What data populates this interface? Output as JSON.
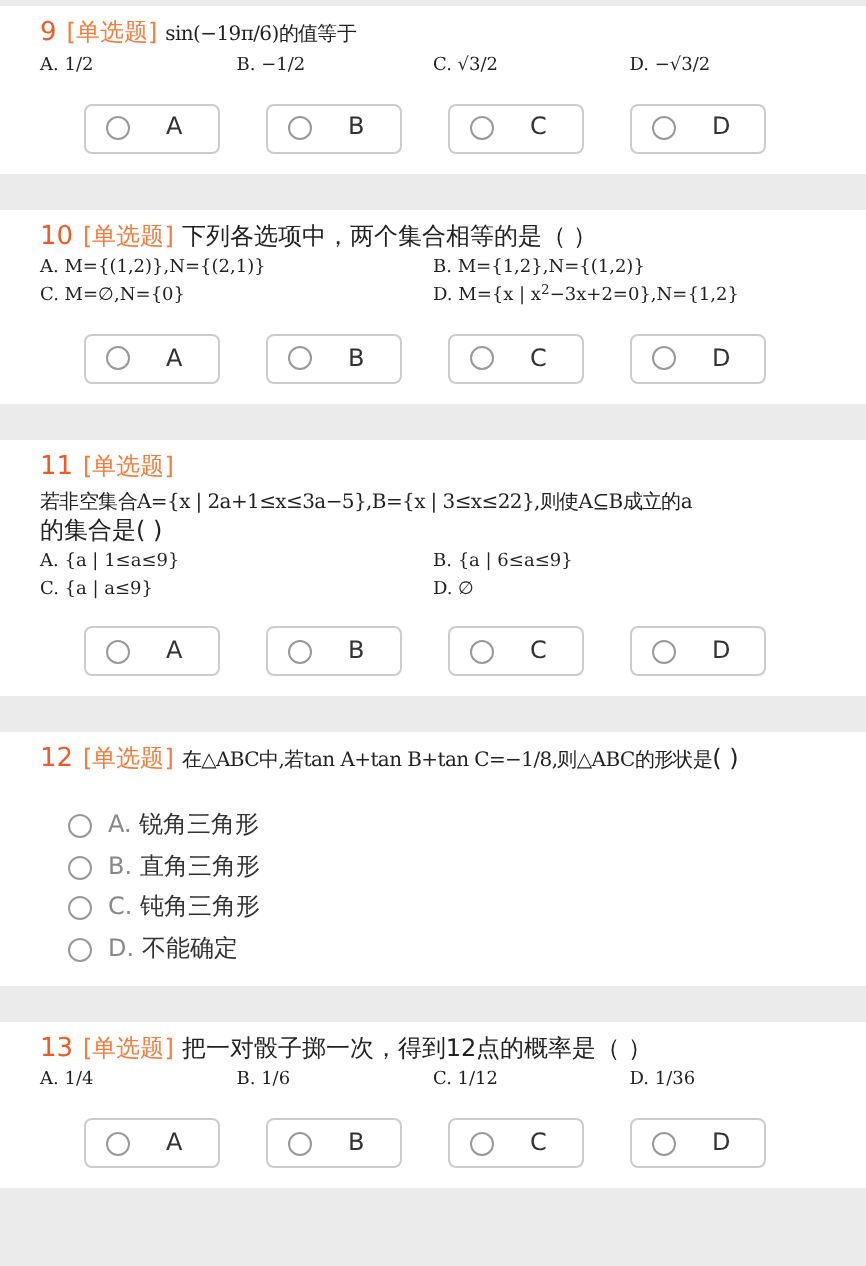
{
  "questions": [
    {
      "number": "9",
      "type_label": "[单选题]",
      "stem_math": "sin(−19π/6)的值等于",
      "kind": "buttons",
      "formula_options": [
        [
          "A. 1/2",
          "B. −1/2",
          "C. √3/2",
          "D. −√3/2"
        ]
      ],
      "choices": [
        {
          "letter": "A",
          "selected": false
        },
        {
          "letter": "B",
          "selected": false
        },
        {
          "letter": "C",
          "selected": false
        },
        {
          "letter": "D",
          "selected": false
        }
      ]
    },
    {
      "number": "10",
      "type_label": "[单选题]",
      "stem": "下列各选项中，两个集合相等的是（        ）",
      "kind": "buttons",
      "formula_options": [
        [
          "A. M={(1,2)},N={(2,1)}",
          "B. M={1,2},N={(1,2)}"
        ],
        [
          "C. M=∅,N={0}",
          "D. M={x | x$^{2}$−3x+2=0},N={1,2}"
        ]
      ],
      "choices": [
        {
          "letter": "A",
          "selected": false
        },
        {
          "letter": "B",
          "selected": false
        },
        {
          "letter": "C",
          "selected": false
        },
        {
          "letter": "D",
          "selected": false
        }
      ]
    },
    {
      "number": "11",
      "type_label": "[单选题]",
      "stem_math": "若非空集合A={x | 2a+1≤x≤3a−5},B={x | 3≤x≤22},则使A⊆B成立的a",
      "stem": "的集合是(        )",
      "kind": "buttons",
      "formula_options": [
        [
          "A. {a | 1≤a≤9}",
          "B. {a | 6≤a≤9}"
        ],
        [
          "C. {a | a≤9}",
          "D. ∅"
        ]
      ],
      "choices": [
        {
          "letter": "A",
          "selected": false
        },
        {
          "letter": "B",
          "selected": false
        },
        {
          "letter": "C",
          "selected": false
        },
        {
          "letter": "D",
          "selected": false
        }
      ]
    },
    {
      "number": "12",
      "type_label": "[单选题]",
      "stem_math": "在△ABC中,若tan A+tan B+tan C=−1/8,则△ABC的形状是",
      "stem": "(        )",
      "kind": "list",
      "choices": [
        {
          "letter": "A.",
          "text": "锐角三角形",
          "selected": false
        },
        {
          "letter": "B.",
          "text": "直角三角形",
          "selected": false
        },
        {
          "letter": "C.",
          "text": "钝角三角形",
          "selected": false
        },
        {
          "letter": "D.",
          "text": "不能确定",
          "selected": false
        }
      ]
    },
    {
      "number": "13",
      "type_label": "[单选题]",
      "stem": "把一对骰子掷一次，得到12点的概率是（        ）",
      "kind": "buttons",
      "formula_options": [
        [
          "A. 1/4",
          "B. 1/6",
          "C. 1/12",
          "D. 1/36"
        ]
      ],
      "choices": [
        {
          "letter": "A",
          "selected": false
        },
        {
          "letter": "B",
          "selected": false
        },
        {
          "letter": "C",
          "selected": false
        },
        {
          "letter": "D",
          "selected": false
        }
      ]
    }
  ]
}
